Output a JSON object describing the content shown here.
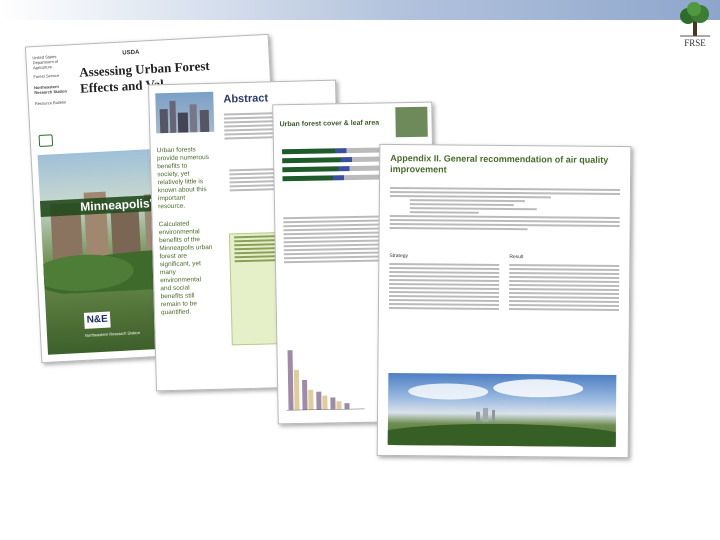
{
  "logo": {
    "text": "FRSE"
  },
  "p1": {
    "agency": [
      "United States",
      "Department of",
      "Agriculture",
      "Forest Service"
    ],
    "station": [
      "Northeastern",
      "Research Station"
    ],
    "bulletin": "Resource Bulletin",
    "title_lines": [
      "Assessing Urban Forest",
      "Effects and Val..."
    ],
    "banner": "Minneapolis' U...",
    "footer": "Northeastern Research Station"
  },
  "p2": {
    "heading": "Abstract",
    "side1": [
      "Urban forests",
      "provide numerous",
      "benefits to",
      "society, yet",
      "relatively little is",
      "known about this",
      "important",
      "resource."
    ],
    "side2": [
      "Calculated",
      "environmental",
      "benefits of the",
      "Minneapolis urban",
      "forest are",
      "significant, yet",
      "many",
      "environmental",
      "and social",
      "benefits still",
      "remain to be",
      "quantified."
    ]
  },
  "p3": {
    "heading": "Urban forest cover & leaf area"
  },
  "p4": {
    "heading_lines": [
      "Appendix II. General recommendation of air quality",
      "improvement"
    ],
    "col1": "Strategy",
    "col2": "Result"
  }
}
